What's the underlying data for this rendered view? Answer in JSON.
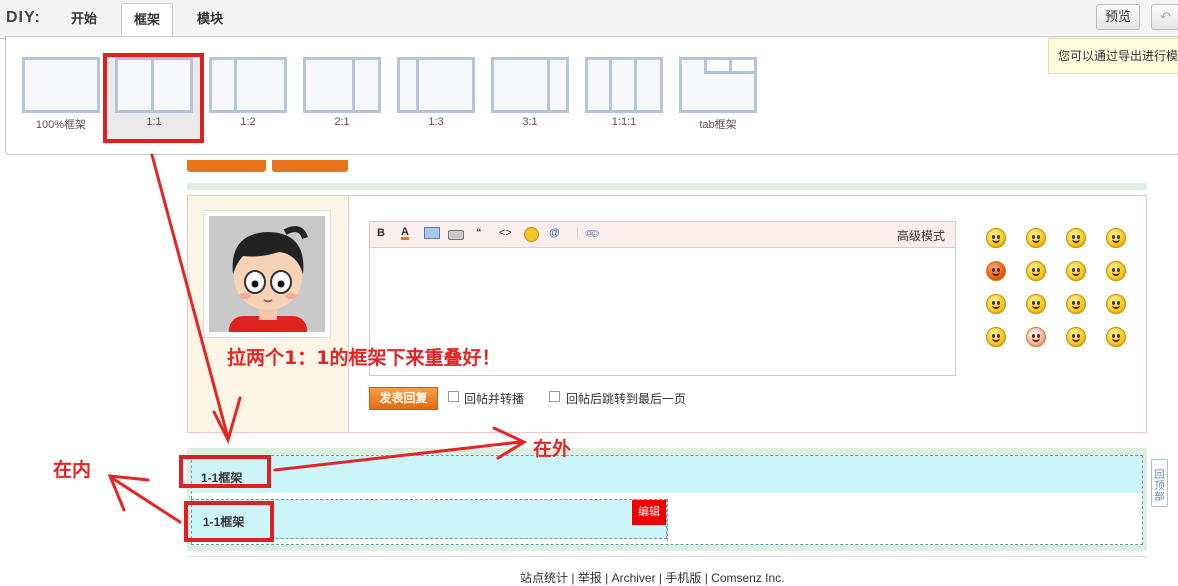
{
  "toolbar": {
    "diy_label": "DIY:",
    "tabs": [
      {
        "label": "开始"
      },
      {
        "label": "框架",
        "active": true
      },
      {
        "label": "模块"
      }
    ],
    "preview_label": "预览",
    "undo_icon": "undo-icon"
  },
  "tip_text": "您可以通过导出进行模",
  "frames": [
    {
      "label": "100%框架",
      "icon": "frame-100-icon"
    },
    {
      "label": "1:1",
      "icon": "frame-1-1-icon",
      "selected": true
    },
    {
      "label": "1:2",
      "icon": "frame-1-2-icon"
    },
    {
      "label": "2:1",
      "icon": "frame-2-1-icon"
    },
    {
      "label": "1:3",
      "icon": "frame-1-3-icon"
    },
    {
      "label": "3:1",
      "icon": "frame-3-1-icon"
    },
    {
      "label": "1:1:1",
      "icon": "frame-1-1-1-icon"
    },
    {
      "label": "tab框架",
      "icon": "frame-tab-icon"
    }
  ],
  "editor": {
    "toolbar_buttons": [
      "B",
      "A",
      "image-icon",
      "link-icon",
      "“",
      "<>",
      "smiley-icon",
      "@",
      "attach-icon"
    ],
    "advanced_mode": "高级模式"
  },
  "reply": {
    "submit_label": "发表回复",
    "option1": "回帖并转播",
    "option2": "回帖后跳转到最后一页"
  },
  "frames_in_page": {
    "outer_title": "1-1框架",
    "inner_title": "1-1框架",
    "edit_label": "编辑"
  },
  "back_to_top": "回顶部",
  "footer_text": "站点统计 | 举报 | Archiver | 手机版 | Comsenz Inc.",
  "annotations": {
    "instruction": "拉两个1：1的框架下来重叠好！",
    "outer": "在外",
    "inner": "在内"
  },
  "colors": {
    "annotation_red": "#e32525",
    "frame_cyan": "#cbf5f8",
    "submit_orange": "#e8741c"
  }
}
